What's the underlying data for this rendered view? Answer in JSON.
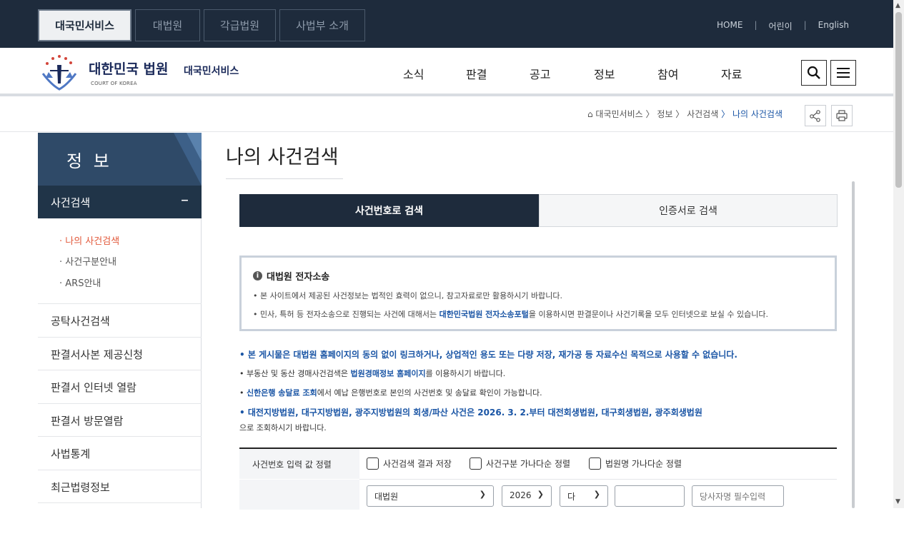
{
  "topbar": {
    "tabs": [
      "대국민서비스",
      "대법원",
      "각급법원",
      "사법부 소개"
    ],
    "links": [
      "HOME",
      "어린이",
      "English"
    ]
  },
  "header": {
    "logo_title": "대한민국 법원",
    "logo_sub": "COURT OF KOREA",
    "service": "대국민서비스",
    "gnb": [
      "소식",
      "판결",
      "공고",
      "정보",
      "참여",
      "자료"
    ]
  },
  "breadcrumb": {
    "items": [
      "대국민서비스",
      "정보",
      "사건검색"
    ],
    "current": "나의 사건검색",
    "sep": "〉"
  },
  "side": {
    "title": "정 보",
    "active": "사건검색",
    "active_toggle": "–",
    "sub": [
      "나의 사건검색",
      "사건구분안내",
      "ARS안내"
    ],
    "items": [
      "공탁사건검색",
      "판결서사본 제공신청",
      "판결서 인터넷 열람",
      "판결서 방문열람",
      "사법통계",
      "최근법령정보"
    ]
  },
  "main": {
    "title": "나의 사건검색",
    "tabs": [
      "사건번호로 검색",
      "인증서로 검색"
    ],
    "notice": {
      "heading": "대법원 전자소송",
      "p1": "본 사이트에서 제공된 사건정보는 법적인 효력이 없으니, 참고자료로만 활용하시기 바랍니다.",
      "p2a": "민사, 특허 등 전자소송으로 진행되는 사건에 대해서는 ",
      "p2b": "대한민국법원 전자소송포털",
      "p2c": "을 이용하시면 판결문이나 사건기록을 모두 인터넷으로 보실 수 있습니다."
    },
    "lines": {
      "l1": "본 게시물은 대법원 홈페이지의 동의 없이 링크하거나, 상업적인 용도 또는 다량 저장, 재가공 등 자료수신 목적으로 사용할 수 없습니다.",
      "l2a": "부동산 및 동산 경매사건검색은 ",
      "l2b": "법원경매정보 홈페이지",
      "l2c": "를 이용하시기 바랍니다.",
      "l3a": "신한은행 송달료 조회",
      "l3b": "에서 예납 은행번호로 본인의 사건번호 및 송달료 확인이 가능합니다.",
      "l4": "대전지방법원, 대구지방법원, 광주지방법원의 회생/파산 사건은 2026. 3. 2.부터 대전회생법원, 대구회생법원, 광주회생법원",
      "l4b": "으로 조회하시기 바랍니다."
    },
    "form": {
      "sort_label": "사건번호 입력 값 정렬",
      "checks": [
        "사건검색 결과 저장",
        "사건구분 가나다순 정렬",
        "법원명 가나다순 정렬"
      ],
      "court": "대법원",
      "year": "2026",
      "type": "다",
      "party_placeholder": "당사자명 필수입력"
    }
  }
}
